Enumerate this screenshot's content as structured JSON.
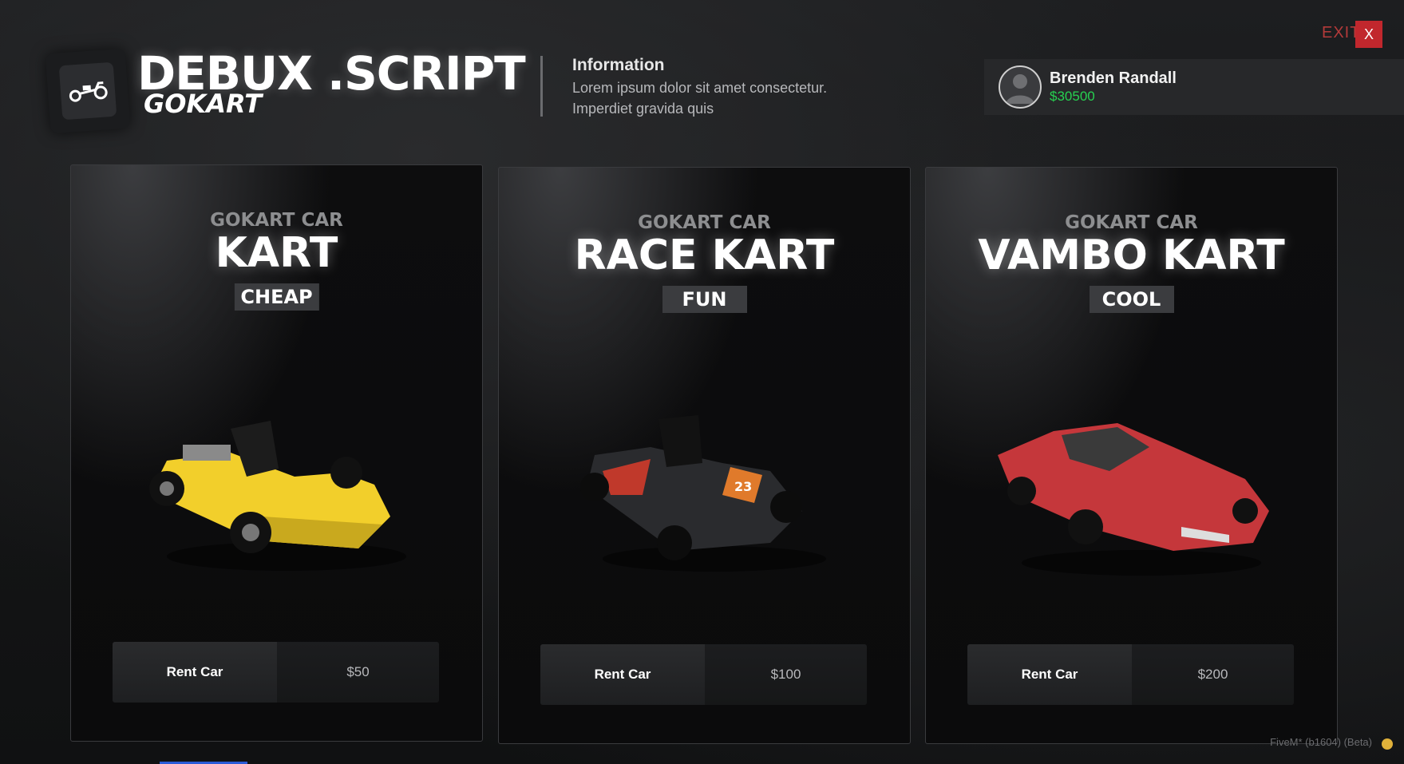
{
  "header": {
    "brand_title": "DEBUX .SCRIPT",
    "brand_subtitle": "GOKART",
    "logo_icon": "gokart-icon",
    "info_title": "Information",
    "info_text": "Lorem ipsum dolor sit amet consectetur. Imperdiet gravida quis"
  },
  "user": {
    "name": "Brenden Randall",
    "money": "$30500",
    "avatar_icon": "user-avatar-icon"
  },
  "exit": {
    "label": "EXIT",
    "button": "X"
  },
  "cards": [
    {
      "category": "GOKART CAR",
      "title": "KART",
      "tag": "CHEAP",
      "rent_label": "Rent Car",
      "price": "$50",
      "color": "#f2cf2b"
    },
    {
      "category": "GOKART CAR",
      "title": "RACE KART",
      "tag": "FUN",
      "rent_label": "Rent Car",
      "price": "$100",
      "color": "#2a2b2e"
    },
    {
      "category": "GOKART CAR",
      "title": "VAMBO KART",
      "tag": "COOL",
      "rent_label": "Rent Car",
      "price": "$200",
      "color": "#c5373b"
    }
  ],
  "footer": {
    "version": "FiveM* (b1604) (Beta)"
  }
}
